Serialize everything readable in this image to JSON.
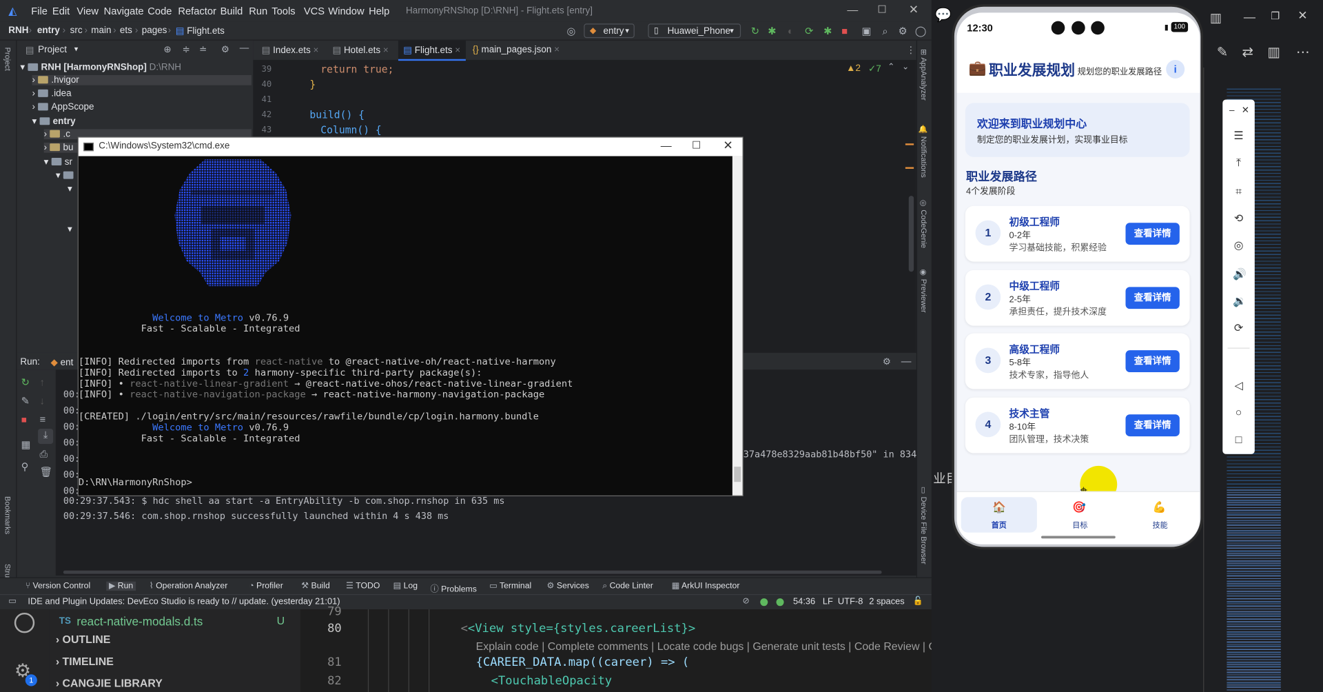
{
  "ide": {
    "menu": [
      "File",
      "Edit",
      "View",
      "Navigate",
      "Code",
      "Refactor",
      "Build",
      "Run",
      "Tools",
      "VCS",
      "Window",
      "Help"
    ],
    "window_title": "HarmonyRNShop [D:\\RNH] - Flight.ets [entry]",
    "breadcrumb": [
      "RNH",
      "entry",
      "src",
      "main",
      "ets",
      "pages",
      "Flight.ets"
    ],
    "run_config": "entry",
    "device": "Huawei_Phone",
    "project_label": "Project",
    "tree": [
      {
        "label": "RNH [HarmonyRNShop]",
        "extra": "D:\\RNH"
      },
      {
        "label": ".hvigor"
      },
      {
        "label": ".idea"
      },
      {
        "label": "AppScope"
      },
      {
        "label": "entry"
      },
      {
        "label": ".c"
      },
      {
        "label": "bu"
      },
      {
        "label": "sr"
      }
    ],
    "tabs": [
      "Index.ets",
      "Hotel.ets",
      "Flight.ets",
      "main_pages.json"
    ],
    "line_numbers": [
      "39",
      "40",
      "41",
      "42",
      "43"
    ],
    "code_lines": [
      "return true;",
      "}",
      "",
      "build() {",
      "Column() {"
    ],
    "warnings": "▲2",
    "checks": "✓7",
    "run_tab": "Run:",
    "run_tab_name": "ent",
    "log_lines": [
      "00:",
      "00:",
      "00:",
      "00:",
      "00:",
      "00:",
      "00:",
      "00:29:37.543: $ hdc shell aa start -a EntryAbility -b com.shop.rnshop in 635 ms",
      "00:29:37.546: com.shop.rnshop successfully launched within 4 s 438 ms"
    ],
    "log_right": "37a478e8329aab81b48bf50\" in 834",
    "bottom_tools": [
      "Version Control",
      "Run",
      "Operation Analyzer",
      "Profiler",
      "Build",
      "TODO",
      "Log",
      "Problems",
      "Terminal",
      "Services",
      "Code Linter",
      "ArkUI Inspector"
    ],
    "status_msg": "IDE and Plugin Updates: DevEco Studio is ready to // update. (yesterday 21:01)",
    "status_right": [
      "54:36",
      "LF",
      "UTF-8",
      "2 spaces"
    ],
    "side_labels": [
      "AppAnalyzer",
      "Notifications",
      "CodeGenie",
      "Previewer",
      "Device File Browser"
    ],
    "left_labels": [
      "Project",
      "Bookmarks",
      "Structure"
    ]
  },
  "cmd": {
    "title": "C:\\Windows\\System32\\cmd.exe",
    "welcome": "Welcome to Metro",
    "version": "v0.76.9",
    "tagline": "Fast - Scalable - Integrated",
    "info1_pre": "[INFO] Redirected imports from ",
    "info1_a": "react-native",
    "info1_b": " to @react-native-oh/react-native-harmony",
    "info2_pre": "[INFO] Redirected imports to ",
    "info2_n": "2",
    "info2_post": " harmony-specific third-party package(s):",
    "info3_pre": "[INFO] • ",
    "info3_a": "react-native-linear-gradient",
    "info3_b": " → @react-native-ohos/react-native-linear-gradient",
    "info4_pre": "[INFO] • ",
    "info4_a": "react-native-navigation-package",
    "info4_b": " → react-native-harmony-navigation-package",
    "created": "[CREATED] ./login/entry/src/main/resources/rawfile/bundle/cp/login.harmony.bundle",
    "prompt": "D:\\RN\\HarmonyRnShop>"
  },
  "vscode": {
    "file": "react-native-modals.d.ts",
    "file_badge": "U",
    "file_type": "TS",
    "sections": [
      "OUTLINE",
      "TIMELINE",
      "CANGJIE LIBRARY"
    ],
    "gear_badge": "1",
    "line_nums": [
      "79",
      "80",
      "81",
      "82"
    ],
    "code80": "<View style={styles.careerList}>",
    "hint": "Explain code | Complete comments | Locate code bugs | Generate unit tests | Code Review | Close",
    "code81": "{CAREER_DATA.map((career) => (",
    "code82": "<TouchableOpacity",
    "cut_text": "业目"
  },
  "phone": {
    "time": "12:30",
    "battery": "100",
    "header_title": "职业发展规划",
    "header_sub": "规划您的职业发展路径",
    "welcome_title": "欢迎来到职业规划中心",
    "welcome_sub": "制定您的职业发展计划，实现事业目标",
    "section_title": "职业发展路径",
    "section_sub": "4个发展阶段",
    "button_label": "查看详情",
    "careers": [
      {
        "num": "1",
        "title": "初级工程师",
        "years": "0-2年",
        "desc": "学习基础技能，积累经验"
      },
      {
        "num": "2",
        "title": "中级工程师",
        "years": "2-5年",
        "desc": "承担责任，提升技术深度"
      },
      {
        "num": "3",
        "title": "高级工程师",
        "years": "5-8年",
        "desc": "技术专家，指导他人"
      },
      {
        "num": "4",
        "title": "技术主管",
        "years": "8-10年",
        "desc": "团队管理，技术决策"
      }
    ],
    "nav": [
      {
        "label": "首页",
        "icon": "home-icon"
      },
      {
        "label": "目标",
        "icon": "target-icon"
      },
      {
        "label": "技能",
        "icon": "muscle-icon"
      }
    ]
  }
}
